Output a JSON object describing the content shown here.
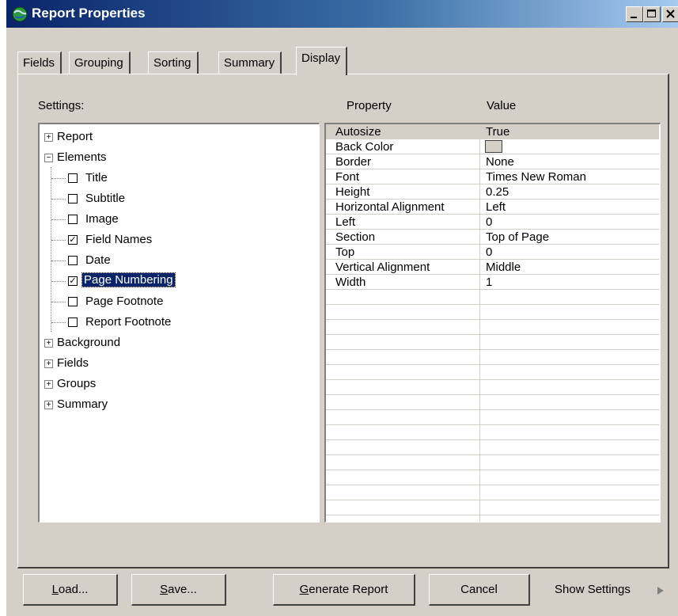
{
  "window": {
    "title": "Report Properties",
    "controls": {
      "minimize": "_",
      "maximize": "□",
      "close": "×"
    }
  },
  "tabs": [
    {
      "label": "Fields",
      "active": false
    },
    {
      "label": "Grouping",
      "active": false
    },
    {
      "label": "Sorting",
      "active": false
    },
    {
      "label": "Summary",
      "active": false
    },
    {
      "label": "Display",
      "active": true
    }
  ],
  "settings_label": "Settings:",
  "property_header": "Property",
  "value_header": "Value",
  "tree": [
    {
      "label": "Report",
      "type": "expandable",
      "expanded": false
    },
    {
      "label": "Elements",
      "type": "expandable",
      "expanded": true
    },
    {
      "label": "Title",
      "type": "checkbox",
      "checked": false
    },
    {
      "label": "Subtitle",
      "type": "checkbox",
      "checked": false
    },
    {
      "label": "Image",
      "type": "checkbox",
      "checked": false
    },
    {
      "label": "Field Names",
      "type": "checkbox",
      "checked": true
    },
    {
      "label": "Date",
      "type": "checkbox",
      "checked": false
    },
    {
      "label": "Page Numbering",
      "type": "checkbox",
      "checked": true,
      "selected": true
    },
    {
      "label": "Page Footnote",
      "type": "checkbox",
      "checked": false
    },
    {
      "label": "Report Footnote",
      "type": "checkbox",
      "checked": false
    },
    {
      "label": "Background",
      "type": "expandable",
      "expanded": false
    },
    {
      "label": "Fields",
      "type": "expandable",
      "expanded": false
    },
    {
      "label": "Groups",
      "type": "expandable",
      "expanded": false
    },
    {
      "label": "Summary",
      "type": "expandable",
      "expanded": false
    }
  ],
  "properties": [
    {
      "property": "Autosize",
      "value": "True"
    },
    {
      "property": "Back Color",
      "value": "",
      "swatch_color": "#d4d0c8"
    },
    {
      "property": "Border",
      "value": "None"
    },
    {
      "property": "Font",
      "value": "Times New Roman"
    },
    {
      "property": "Height",
      "value": "0.25"
    },
    {
      "property": "Horizontal Alignment",
      "value": "Left"
    },
    {
      "property": "Left",
      "value": "0"
    },
    {
      "property": "Section",
      "value": "Top of Page"
    },
    {
      "property": "Top",
      "value": "0"
    },
    {
      "property": "Vertical Alignment",
      "value": "Middle"
    },
    {
      "property": "Width",
      "value": "1"
    }
  ],
  "buttons": {
    "load": {
      "mnemonic": "L",
      "rest": "oad..."
    },
    "save": {
      "mnemonic": "S",
      "rest": "ave..."
    },
    "generate": {
      "mnemonic": "G",
      "rest": "enerate Report"
    },
    "cancel": "Cancel",
    "show_settings": "Show Settings"
  },
  "colors": {
    "title_gradient_start": "#0a246a",
    "title_gradient_end": "#a6caf0",
    "face": "#d4d0c8",
    "selection": "#0a246a"
  }
}
